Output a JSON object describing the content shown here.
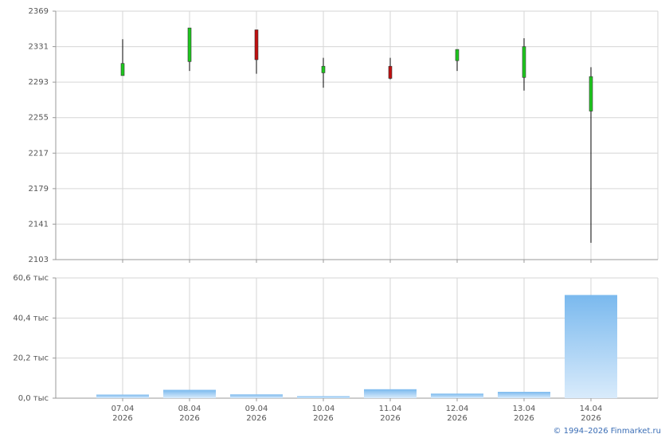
{
  "copyright": "© 1994–2026 Finmarket.ru",
  "colors": {
    "up": "#1ec71e",
    "down": "#c01010",
    "wick": "#000000",
    "grid": "#d6d6d6",
    "axis": "#999999",
    "volume_top": "#7ab9ee",
    "volume_bottom": "#d9ebfb"
  },
  "chart_data": [
    {
      "type": "candlestick",
      "categories": [
        "07.04\n2026",
        "08.04\n2026",
        "09.04\n2026",
        "10.04\n2026",
        "11.04\n2026",
        "12.04\n2026",
        "13.04\n2026",
        "14.04\n2026"
      ],
      "ylim": [
        2103,
        2369
      ],
      "yticks": [
        "2369",
        "2331",
        "2293",
        "2255",
        "2217",
        "2179",
        "2141",
        "2103"
      ],
      "grid": true,
      "candles": [
        {
          "open": 2300,
          "close": 2313,
          "high": 2339,
          "low": 2300
        },
        {
          "open": 2315,
          "close": 2351,
          "high": 2351,
          "low": 2305
        },
        {
          "open": 2349,
          "close": 2317,
          "high": 2349,
          "low": 2302
        },
        {
          "open": 2303,
          "close": 2310,
          "high": 2319,
          "low": 2287
        },
        {
          "open": 2310,
          "close": 2297,
          "high": 2319,
          "low": 2296
        },
        {
          "open": 2316,
          "close": 2328,
          "high": 2328,
          "low": 2305
        },
        {
          "open": 2298,
          "close": 2331,
          "high": 2340,
          "low": 2284
        },
        {
          "open": 2262,
          "close": 2299,
          "high": 2309,
          "low": 2121
        }
      ]
    },
    {
      "type": "bar",
      "categories": [
        "07.04\n2026",
        "08.04\n2026",
        "09.04\n2026",
        "10.04\n2026",
        "11.04\n2026",
        "12.04\n2026",
        "13.04\n2026",
        "14.04\n2026"
      ],
      "values": [
        1.8,
        4.2,
        1.9,
        1.0,
        4.5,
        2.3,
        3.2,
        52.0
      ],
      "unit": "тыс",
      "ylim": [
        0,
        60.6
      ],
      "yticks": [
        "60,6 тыс",
        "40,4 тыс",
        "20,2 тыс",
        "0,0 тыс"
      ],
      "grid": true
    }
  ]
}
